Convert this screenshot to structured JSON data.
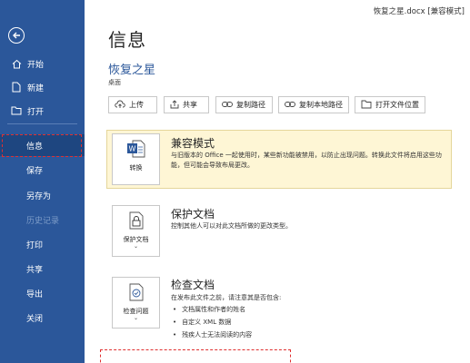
{
  "titlebar": {
    "document_title": "恢复之星.docx [兼容模式]"
  },
  "sidebar": {
    "items": [
      {
        "label": "开始",
        "icon": "home-icon"
      },
      {
        "label": "新建",
        "icon": "new-document-icon"
      },
      {
        "label": "打开",
        "icon": "folder-open-icon"
      },
      {
        "label": "信息",
        "active": true
      },
      {
        "label": "保存"
      },
      {
        "label": "另存为"
      },
      {
        "label": "历史记录",
        "disabled": true
      },
      {
        "label": "打印"
      },
      {
        "label": "共享"
      },
      {
        "label": "导出"
      },
      {
        "label": "关闭"
      }
    ]
  },
  "main": {
    "title": "信息",
    "document_name": "恢复之星",
    "document_location": "桌面",
    "toolbar": [
      {
        "label": "上传",
        "icon": "upload-icon"
      },
      {
        "label": "共享",
        "icon": "share-icon"
      },
      {
        "label": "复制路径",
        "icon": "link-icon"
      },
      {
        "label": "复制本地路径",
        "icon": "link-icon"
      },
      {
        "label": "打开文件位置",
        "icon": "folder-icon"
      }
    ],
    "compat": {
      "button_label": "转换",
      "title": "兼容模式",
      "description": "与旧版本的 Office 一起使用时，某些新功能被禁用，以防止出现问题。转换此文件将启用这些功能，但可能会导致布局更改。"
    },
    "protect": {
      "button_label": "保护文档",
      "title": "保护文档",
      "description": "控制其他人可以对此文档所做的更改类型。"
    },
    "inspect": {
      "button_label": "检查问题",
      "title": "检查文档",
      "description": "在发布此文件之前，请注意其是否包含:",
      "bullets": [
        "文档属性和作者的姓名",
        "自定义 XML 数据",
        "残疾人士无法阅读的内容"
      ]
    }
  },
  "colors": {
    "sidebar": "#2b579a",
    "accent": "#2b579a",
    "compat_bg": "#fef6d5",
    "highlight": "#e03030"
  }
}
